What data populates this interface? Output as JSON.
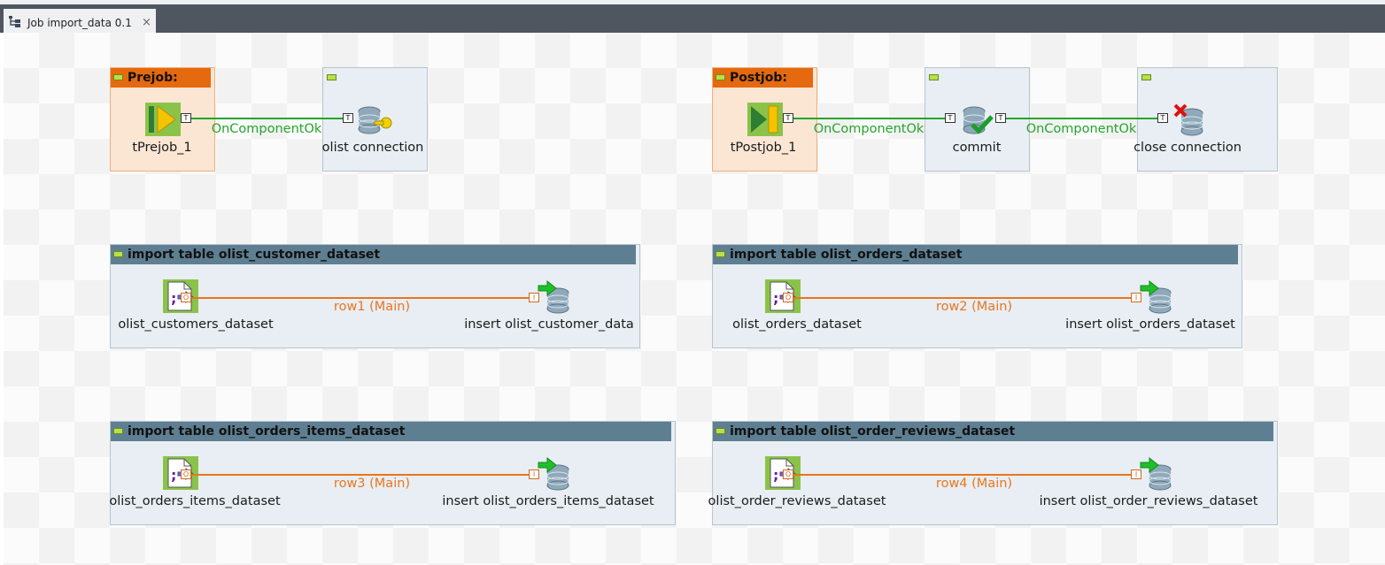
{
  "tab": {
    "title": "Job import_data 0.1",
    "close": "×"
  },
  "prejob": {
    "header": "Prejob:",
    "component": "tPrejob_1",
    "link": "OnComponentOk",
    "target": "olist connection"
  },
  "postjob": {
    "header": "Postjob:",
    "component": "tPostjob_1",
    "link1": "OnComponentOk",
    "commit": "commit",
    "link2": "OnComponentOk",
    "close": "close connection"
  },
  "subjobs": [
    {
      "title": "import table olist_customer_dataset",
      "source": "olist_customers_dataset",
      "link": "row1 (Main)",
      "target": "insert olist_customer_data"
    },
    {
      "title": "import table olist_orders_dataset",
      "source": "olist_orders_dataset",
      "link": "row2 (Main)",
      "target": "insert olist_orders_dataset"
    },
    {
      "title": "import table olist_orders_items_dataset",
      "source": "olist_orders_items_dataset",
      "link": "row3 (Main)",
      "target": "insert olist_orders_items_dataset"
    },
    {
      "title": "import table olist_order_reviews_dataset",
      "source": "olist_order_reviews_dataset",
      "link": "row4 (Main)",
      "target": "insert olist_order_reviews_dataset"
    }
  ],
  "connectors": {
    "trigger": "T",
    "output": "O",
    "input": "I"
  },
  "colors": {
    "trigger_link": "#23a62a",
    "row_link": "#e8761f",
    "prejob_header": "#e5690e",
    "subjob_header": "#5e7f92"
  }
}
